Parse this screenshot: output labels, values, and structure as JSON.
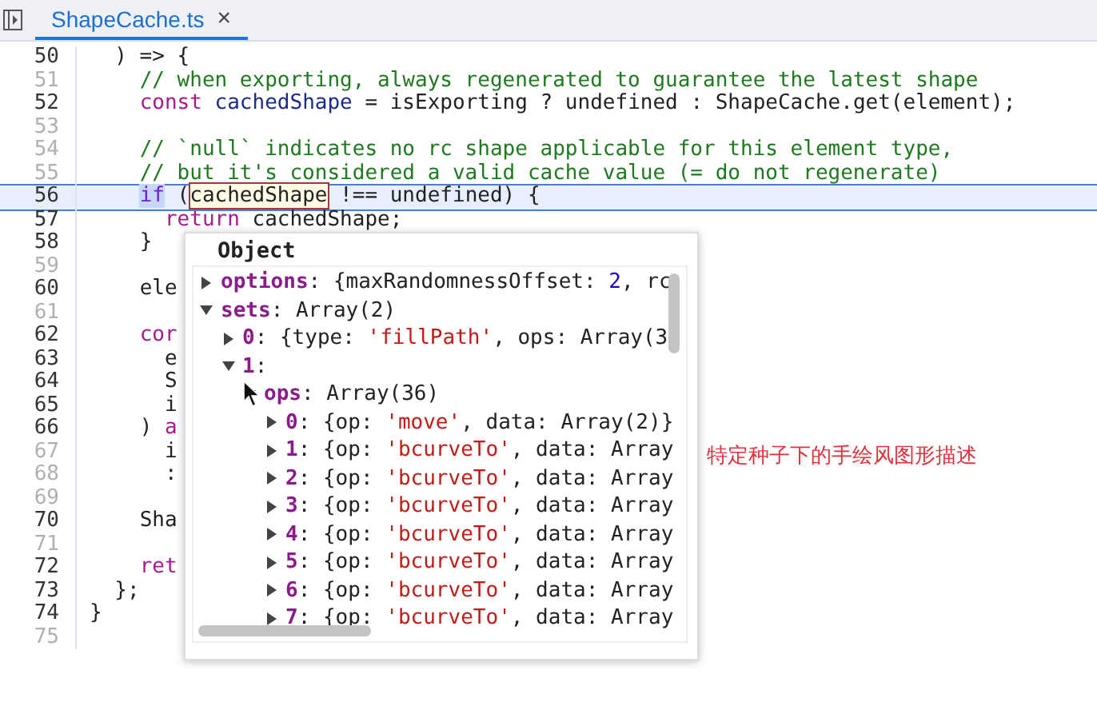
{
  "tab": {
    "title": "ShapeCache.ts",
    "selected": true,
    "close": "×"
  },
  "code_lines": [
    {
      "number": "50",
      "muted": false,
      "selected": false,
      "tokens": [
        {
          "t": "  ) => {",
          "kind": "plain"
        }
      ]
    },
    {
      "number": "51",
      "muted": true,
      "selected": false,
      "tokens": [
        {
          "t": "    // when exporting, always regenerated to guarantee the latest shape",
          "kind": "comment"
        }
      ]
    },
    {
      "number": "52",
      "muted": false,
      "selected": false,
      "tokens": [
        {
          "t": "    const",
          "kind": "keyword"
        },
        {
          "t": " cachedShape",
          "kind": "variable"
        },
        {
          "t": " = isExporting ? undefined : ShapeCache.get(element);",
          "kind": "plain"
        }
      ]
    },
    {
      "number": "53",
      "muted": true,
      "selected": false
    },
    {
      "number": "54",
      "muted": true,
      "selected": false,
      "tokens": [
        {
          "t": "    // `null` indicates no rc shape applicable for this element type,",
          "kind": "comment"
        }
      ]
    },
    {
      "number": "55",
      "muted": true,
      "selected": false,
      "tokens": [
        {
          "t": "    // but it's considered a valid cache value (= do not regenerate)",
          "kind": "comment"
        }
      ]
    },
    {
      "number": "56",
      "muted": false,
      "selected": true,
      "tokens": [
        {
          "t": "    if",
          "kind": "keyword-highlight"
        },
        {
          "t": " (",
          "kind": "plain"
        },
        {
          "t": "cachedShape",
          "kind": "hovered"
        },
        {
          "t": " !== undefined) {",
          "kind": "plain"
        }
      ]
    },
    {
      "number": "57",
      "muted": false,
      "selected": false,
      "tokens": [
        {
          "t": "      return",
          "kind": "keyword"
        },
        {
          "t": " cachedShape;",
          "kind": "plain"
        }
      ]
    },
    {
      "number": "58",
      "muted": false,
      "selected": false,
      "tokens": [
        {
          "t": "    }",
          "kind": "plain"
        }
      ]
    },
    {
      "number": "59",
      "muted": true,
      "selected": false
    },
    {
      "number": "60",
      "muted": false,
      "selected": false,
      "tokens": [
        {
          "t": "    ele",
          "kind": "plain"
        }
      ]
    },
    {
      "number": "61",
      "muted": true,
      "selected": false
    },
    {
      "number": "62",
      "muted": false,
      "selected": false,
      "tokens": [
        {
          "t": "    cor",
          "kind": "keyword"
        }
      ]
    },
    {
      "number": "63",
      "muted": false,
      "selected": false,
      "tokens": [
        {
          "t": "      e",
          "kind": "plain"
        }
      ]
    },
    {
      "number": "64",
      "muted": false,
      "selected": false,
      "tokens": [
        {
          "t": "      S",
          "kind": "plain"
        }
      ]
    },
    {
      "number": "65",
      "muted": false,
      "selected": false,
      "tokens": [
        {
          "t": "      i",
          "kind": "plain"
        }
      ]
    },
    {
      "number": "66",
      "muted": false,
      "selected": false,
      "tokens": [
        {
          "t": "    )",
          "kind": "plain"
        },
        {
          "t": " a",
          "kind": "keyword"
        }
      ]
    },
    {
      "number": "67",
      "muted": true,
      "selected": false,
      "tokens": [
        {
          "t": "      i",
          "kind": "plain"
        }
      ]
    },
    {
      "number": "68",
      "muted": true,
      "selected": false,
      "tokens": [
        {
          "t": "      :",
          "kind": "plain"
        }
      ]
    },
    {
      "number": "69",
      "muted": true,
      "selected": false
    },
    {
      "number": "70",
      "muted": false,
      "selected": false,
      "tokens": [
        {
          "t": "    Sha",
          "kind": "plain"
        }
      ]
    },
    {
      "number": "71",
      "muted": true,
      "selected": false
    },
    {
      "number": "72",
      "muted": false,
      "selected": false,
      "tokens": [
        {
          "t": "    ret",
          "kind": "keyword"
        }
      ]
    },
    {
      "number": "73",
      "muted": false,
      "selected": false,
      "tokens": [
        {
          "t": "  };",
          "kind": "plain"
        }
      ]
    },
    {
      "number": "74",
      "muted": false,
      "selected": false,
      "tokens": [
        {
          "t": "}",
          "kind": "plain"
        }
      ]
    },
    {
      "number": "75",
      "muted": true,
      "selected": false
    }
  ],
  "popup": {
    "title": "Object",
    "tree": [
      {
        "key": "options",
        "expanded": false,
        "value": [
          {
            "t": ": {maxRandomnessOffset: ",
            "kind": "plain"
          },
          {
            "t": "2",
            "kind": "number"
          },
          {
            "t": ", rc",
            "kind": "plain"
          }
        ]
      },
      {
        "key": "sets",
        "expanded": true,
        "value": [
          {
            "t": ": Array(2)",
            "kind": "plain"
          }
        ],
        "children": [
          {
            "key": "0",
            "expanded": false,
            "value": [
              {
                "t": ": {type: ",
                "kind": "plain"
              },
              {
                "t": "'fillPath'",
                "kind": "string"
              },
              {
                "t": ", ops: Array(3",
                "kind": "plain"
              }
            ]
          },
          {
            "key": "1",
            "expanded": true,
            "value": [
              {
                "t": ":",
                "kind": "plain"
              }
            ],
            "children": [
              {
                "key": "ops",
                "expanded": true,
                "value": [
                  {
                    "t": ": Array(36)",
                    "kind": "plain"
                  }
                ],
                "children": [
                  {
                    "key": "0",
                    "expanded": false,
                    "value": [
                      {
                        "t": ": {op: ",
                        "kind": "plain"
                      },
                      {
                        "t": "'move'",
                        "kind": "string"
                      },
                      {
                        "t": ", data: Array(2)}",
                        "kind": "plain"
                      }
                    ]
                  },
                  {
                    "key": "1",
                    "expanded": false,
                    "value": [
                      {
                        "t": ": {op: ",
                        "kind": "plain"
                      },
                      {
                        "t": "'bcurveTo'",
                        "kind": "string"
                      },
                      {
                        "t": ", data: Array",
                        "kind": "plain"
                      }
                    ]
                  },
                  {
                    "key": "2",
                    "expanded": false,
                    "value": [
                      {
                        "t": ": {op: ",
                        "kind": "plain"
                      },
                      {
                        "t": "'bcurveTo'",
                        "kind": "string"
                      },
                      {
                        "t": ", data: Array",
                        "kind": "plain"
                      }
                    ]
                  },
                  {
                    "key": "3",
                    "expanded": false,
                    "value": [
                      {
                        "t": ": {op: ",
                        "kind": "plain"
                      },
                      {
                        "t": "'bcurveTo'",
                        "kind": "string"
                      },
                      {
                        "t": ", data: Array",
                        "kind": "plain"
                      }
                    ]
                  },
                  {
                    "key": "4",
                    "expanded": false,
                    "value": [
                      {
                        "t": ": {op: ",
                        "kind": "plain"
                      },
                      {
                        "t": "'bcurveTo'",
                        "kind": "string"
                      },
                      {
                        "t": ", data: Array",
                        "kind": "plain"
                      }
                    ]
                  },
                  {
                    "key": "5",
                    "expanded": false,
                    "value": [
                      {
                        "t": ": {op: ",
                        "kind": "plain"
                      },
                      {
                        "t": "'bcurveTo'",
                        "kind": "string"
                      },
                      {
                        "t": ", data: Array",
                        "kind": "plain"
                      }
                    ]
                  },
                  {
                    "key": "6",
                    "expanded": false,
                    "value": [
                      {
                        "t": ": {op: ",
                        "kind": "plain"
                      },
                      {
                        "t": "'bcurveTo'",
                        "kind": "string"
                      },
                      {
                        "t": ", data: Array",
                        "kind": "plain"
                      }
                    ]
                  },
                  {
                    "key": "7",
                    "expanded": false,
                    "value": [
                      {
                        "t": ": {op: ",
                        "kind": "plain"
                      },
                      {
                        "t": "'bcurveTo'",
                        "kind": "string"
                      },
                      {
                        "t": ", data: Array",
                        "kind": "plain"
                      }
                    ]
                  }
                ]
              }
            ]
          }
        ]
      }
    ]
  },
  "annotation": "特定种子下的手绘风图形描述"
}
